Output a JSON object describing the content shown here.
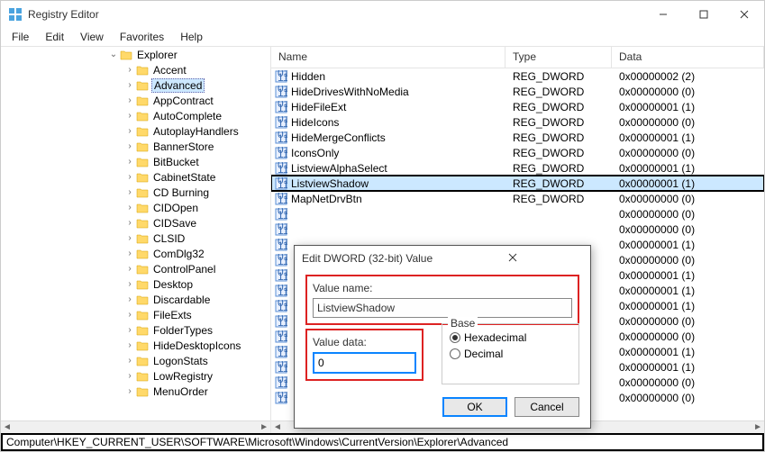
{
  "window": {
    "title": "Registry Editor"
  },
  "menu": {
    "file": "File",
    "edit": "Edit",
    "view": "View",
    "favorites": "Favorites",
    "help": "Help"
  },
  "tree": {
    "root": "Explorer",
    "items": [
      "Accent",
      "Advanced",
      "AppContract",
      "AutoComplete",
      "AutoplayHandlers",
      "BannerStore",
      "BitBucket",
      "CabinetState",
      "CD Burning",
      "CIDOpen",
      "CIDSave",
      "CLSID",
      "ComDlg32",
      "ControlPanel",
      "Desktop",
      "Discardable",
      "FileExts",
      "FolderTypes",
      "HideDesktopIcons",
      "LogonStats",
      "LowRegistry",
      "MenuOrder"
    ],
    "selected": "Advanced"
  },
  "list": {
    "headers": {
      "name": "Name",
      "type": "Type",
      "data": "Data"
    },
    "rows": [
      {
        "name": "Hidden",
        "type": "REG_DWORD",
        "data": "0x00000002 (2)"
      },
      {
        "name": "HideDrivesWithNoMedia",
        "type": "REG_DWORD",
        "data": "0x00000000 (0)"
      },
      {
        "name": "HideFileExt",
        "type": "REG_DWORD",
        "data": "0x00000001 (1)"
      },
      {
        "name": "HideIcons",
        "type": "REG_DWORD",
        "data": "0x00000000 (0)"
      },
      {
        "name": "HideMergeConflicts",
        "type": "REG_DWORD",
        "data": "0x00000001 (1)"
      },
      {
        "name": "IconsOnly",
        "type": "REG_DWORD",
        "data": "0x00000000 (0)"
      },
      {
        "name": "ListviewAlphaSelect",
        "type": "REG_DWORD",
        "data": "0x00000001 (1)"
      },
      {
        "name": "ListviewShadow",
        "type": "REG_DWORD",
        "data": "0x00000001 (1)",
        "selected": true
      },
      {
        "name": "MapNetDrvBtn",
        "type": "REG_DWORD",
        "data": "0x00000000 (0)"
      },
      {
        "name": "",
        "type": "",
        "data": "0x00000000 (0)"
      },
      {
        "name": "",
        "type": "",
        "data": "0x00000000 (0)"
      },
      {
        "name": "",
        "type": "",
        "data": "0x00000001 (1)"
      },
      {
        "name": "",
        "type": "",
        "data": "0x00000000 (0)"
      },
      {
        "name": "",
        "type": "",
        "data": "0x00000001 (1)"
      },
      {
        "name": "",
        "type": "",
        "data": "0x00000001 (1)"
      },
      {
        "name": "",
        "type": "",
        "data": "0x00000001 (1)"
      },
      {
        "name": "",
        "type": "",
        "data": "0x00000000 (0)"
      },
      {
        "name": "",
        "type": "",
        "data": "0x00000000 (0)"
      },
      {
        "name": "",
        "type": "",
        "data": "0x00000001 (1)"
      },
      {
        "name": "",
        "type": "",
        "data": "0x00000001 (1)"
      },
      {
        "name": "",
        "type": "",
        "data": "0x00000000 (0)"
      },
      {
        "name": "",
        "type": "",
        "data": "0x00000000 (0)"
      }
    ]
  },
  "dialog": {
    "title": "Edit DWORD (32-bit) Value",
    "value_name_label": "Value name:",
    "value_name": "ListviewShadow",
    "value_data_label": "Value data:",
    "value_data": "0",
    "base_label": "Base",
    "hex_label": "Hexadecimal",
    "dec_label": "Decimal",
    "ok": "OK",
    "cancel": "Cancel"
  },
  "statusbar": {
    "path": "Computer\\HKEY_CURRENT_USER\\SOFTWARE\\Microsoft\\Windows\\CurrentVersion\\Explorer\\Advanced"
  }
}
